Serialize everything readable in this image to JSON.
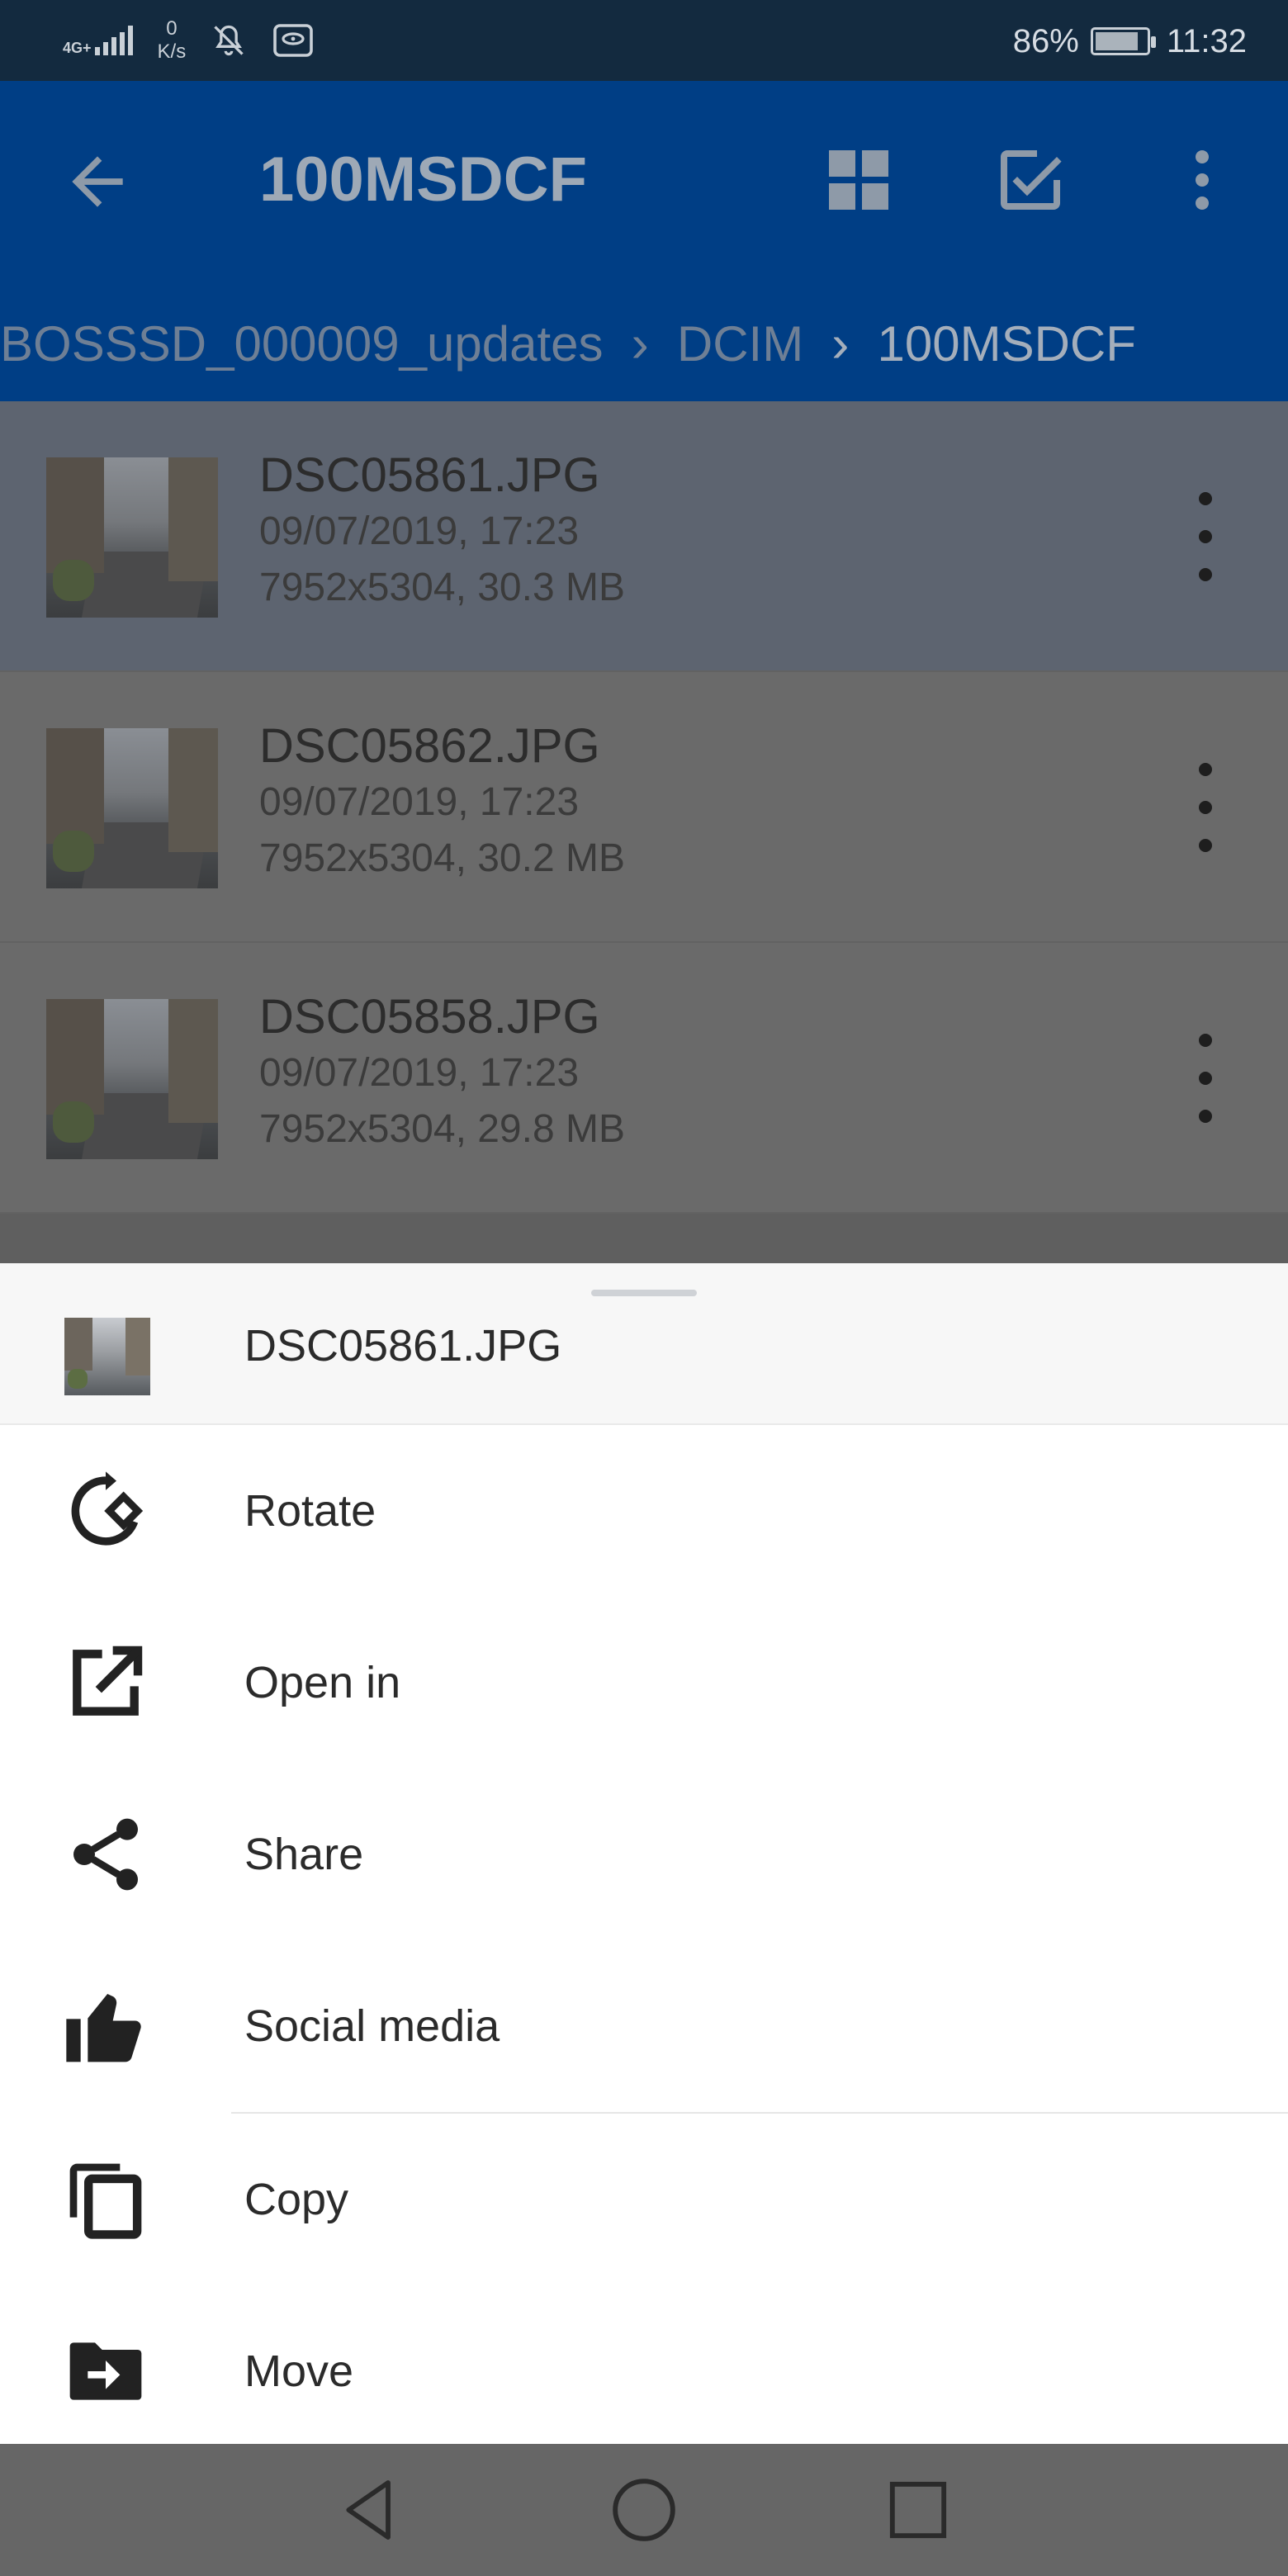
{
  "status_bar": {
    "network": "4G+",
    "speed_value": "0",
    "speed_unit": "K/s",
    "battery": "86%",
    "battery_level": 0.86,
    "time": "11:32"
  },
  "app_bar": {
    "title": "100MSDCF",
    "breadcrumbs": [
      "BOSSSD_000009_updates",
      "DCIM",
      "100MSDCF"
    ]
  },
  "files": [
    {
      "name": "DSC05861.JPG",
      "date": "09/07/2019, 17:23",
      "info": "7952x5304, 30.3 MB"
    },
    {
      "name": "DSC05862.JPG",
      "date": "09/07/2019, 17:23",
      "info": "7952x5304, 30.2 MB"
    },
    {
      "name": "DSC05858.JPG",
      "date": "09/07/2019, 17:23",
      "info": "7952x5304, 29.8 MB"
    }
  ],
  "sheet": {
    "file_name": "DSC05861.JPG",
    "actions": [
      {
        "label": "Rotate",
        "icon": "rotate-icon"
      },
      {
        "label": "Open in",
        "icon": "open-in-icon"
      },
      {
        "label": "Share",
        "icon": "share-icon"
      },
      {
        "label": "Social media",
        "icon": "thumb-up-icon"
      },
      {
        "label": "Copy",
        "icon": "copy-icon"
      },
      {
        "label": "Move",
        "icon": "move-icon"
      }
    ]
  },
  "colors": {
    "app_bar": "#003e85",
    "status_bar": "#132a3f",
    "sheet": "#ffffff",
    "nav_bar": "#666666"
  }
}
